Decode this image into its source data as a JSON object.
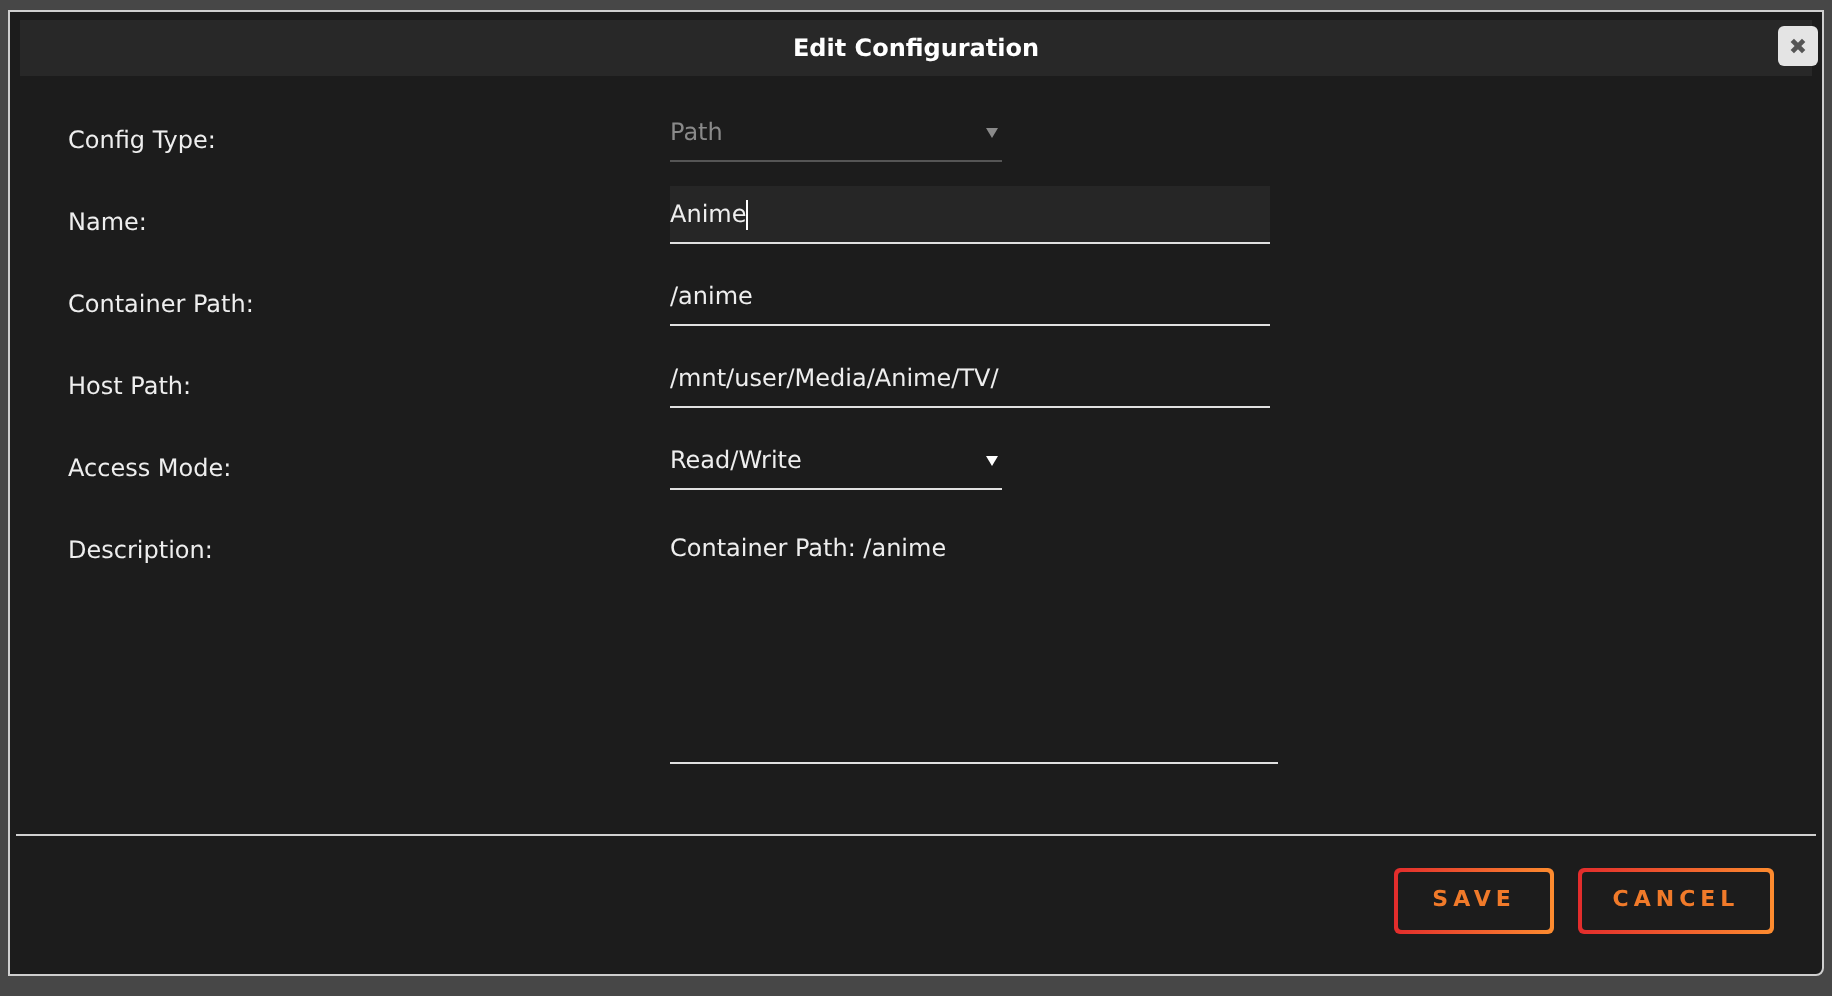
{
  "dialog": {
    "title": "Edit Configuration",
    "close": "✖"
  },
  "fields": [
    {
      "kind": "select",
      "label": "Config Type:",
      "value": "Path",
      "disabled": true
    },
    {
      "kind": "text",
      "label": "Name:",
      "value": "Anime",
      "focused": true
    },
    {
      "kind": "text",
      "label": "Container Path:",
      "value": "/anime",
      "focused": false
    },
    {
      "kind": "text",
      "label": "Host Path:",
      "value": "/mnt/user/Media/Anime/TV/",
      "focused": false
    },
    {
      "kind": "select",
      "label": "Access Mode:",
      "value": "Read/Write",
      "disabled": false
    },
    {
      "kind": "textarea",
      "label": "Description:",
      "value": "Container Path: /anime"
    }
  ],
  "buttons": [
    "SAVE",
    "CANCEL"
  ]
}
